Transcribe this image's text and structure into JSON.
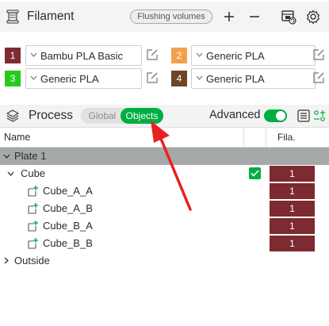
{
  "filament": {
    "title": "Filament",
    "flushing_label": "Flushing volumes",
    "items": [
      {
        "index": "1",
        "color": "#7d2a31",
        "name": "Bambu PLA Basic"
      },
      {
        "index": "2",
        "color": "#f3a04c",
        "name": "Generic PLA"
      },
      {
        "index": "3",
        "color": "#27c91c",
        "name": "Generic PLA"
      },
      {
        "index": "4",
        "color": "#6e4526",
        "name": "Generic PLA"
      }
    ]
  },
  "process": {
    "title": "Process",
    "mode_global": "Global",
    "mode_objects": "Objects",
    "advanced_label": "Advanced",
    "advanced_on": true
  },
  "table": {
    "col_name": "Name",
    "col_fila": "Fila.",
    "rows": [
      {
        "label": "Plate 1",
        "fila": ""
      },
      {
        "label": "Cube",
        "fila": "1"
      },
      {
        "label": "Cube_A_A",
        "fila": "1"
      },
      {
        "label": "Cube_A_B",
        "fila": "1"
      },
      {
        "label": "Cube_B_A",
        "fila": "1"
      },
      {
        "label": "Cube_B_B",
        "fila": "1"
      },
      {
        "label": "Outside",
        "fila": ""
      }
    ]
  },
  "colors": {
    "accent": "#00ae42",
    "annotation_arrow": "#e8201f"
  }
}
